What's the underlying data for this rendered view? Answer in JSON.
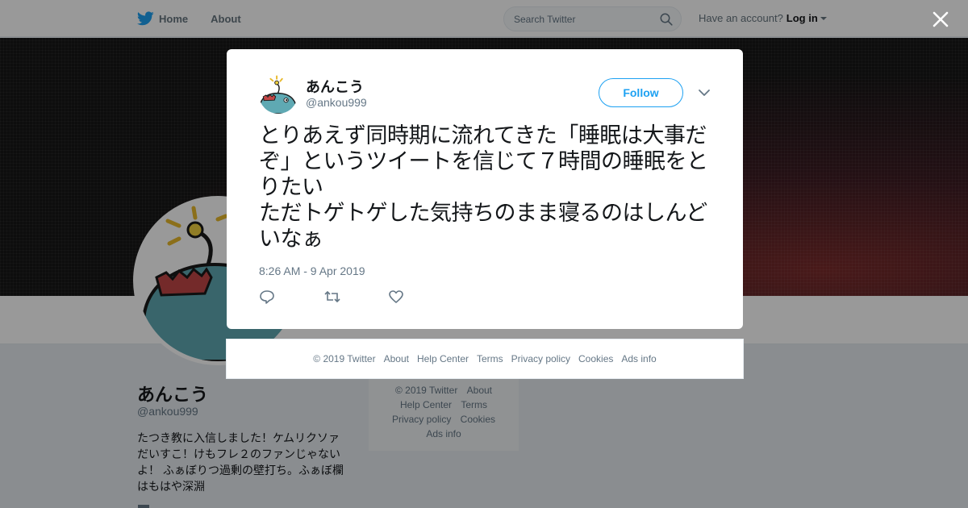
{
  "nav": {
    "home_label": "Home",
    "about_label": "About",
    "search_placeholder": "Search Twitter",
    "have_account": "Have an account?",
    "login_label": "Log in"
  },
  "profile": {
    "name": "あんこう",
    "handle": "@ankou999",
    "bio": "たつき教に入信しました！ケムリクソァだいすこ！けもフレ２のファンじゃないよ！ ふぁぼりつ過剰の壁打ち。ふぁぼ欄はもはや深淵"
  },
  "side_footer": {
    "items": [
      "© 2019 Twitter",
      "About",
      "Help Center",
      "Terms",
      "Privacy policy",
      "Cookies",
      "Ads info"
    ]
  },
  "tweet": {
    "name": "あんこう",
    "handle": "@ankou999",
    "follow_label": "Follow",
    "text": "とりあえず同時期に流れてきた「睡眠は大事だぞ」というツイートを信じて７時間の睡眠をとりたい\nただトゲトゲした気持ちのまま寝るのはしんどいなぁ",
    "timestamp": "8:26 AM - 9 Apr 2019"
  },
  "modal_footer": {
    "items": [
      "© 2019 Twitter",
      "About",
      "Help Center",
      "Terms",
      "Privacy policy",
      "Cookies",
      "Ads info"
    ]
  },
  "colors": {
    "accent": "#1da1f2",
    "muted": "#657786",
    "avatar_fish": "#5fa9b3"
  },
  "icons": {
    "logo": "twitter-bird-icon",
    "search": "search-icon",
    "close": "close-icon",
    "chevron": "chevron-down-icon",
    "reply": "reply-icon",
    "retweet": "retweet-icon",
    "like": "heart-icon"
  }
}
